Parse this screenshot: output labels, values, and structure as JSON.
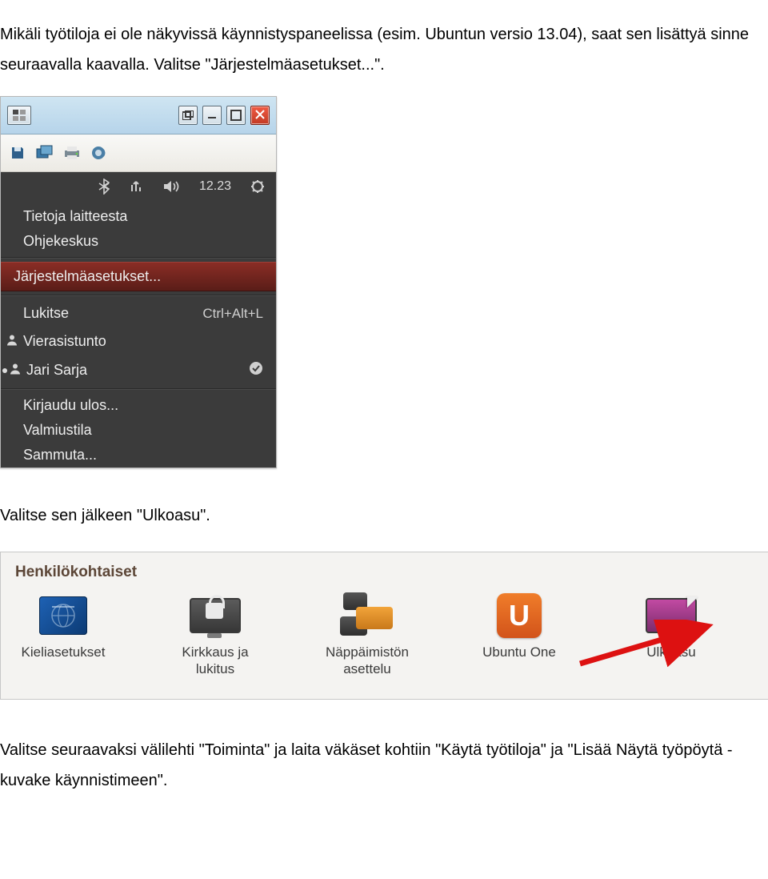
{
  "intro": "Mikäli työtiloja ei ole näkyvissä käynnistyspaneelissa (esim. Ubuntun versio 13.04), saat sen lisättyä sinne seuraavalla kaavalla. Valitse \"Järjestelmäasetukset...\".",
  "after_shot1": "Valitse sen jälkeen \"Ulkoasu\".",
  "outro": "Valitse seuraavaksi välilehti \"Toiminta\" ja laita väkäset kohtiin \"Käytä työtiloja\" ja \"Lisää Näytä työpöytä -kuvake käynnistimeen\".",
  "menu": {
    "time": "12.23",
    "items": {
      "about": "Tietoja laitteesta",
      "help": "Ohjekeskus",
      "settings": "Järjestelmäasetukset...",
      "lock": "Lukitse",
      "lock_shortcut": "Ctrl+Alt+L",
      "guest": "Vierasistunto",
      "user": "Jari Sarja",
      "logout": "Kirjaudu ulos...",
      "suspend": "Valmiustila",
      "shutdown": "Sammuta..."
    }
  },
  "panel": {
    "heading": "Henkilökohtaiset",
    "apps": {
      "lang": "Kieliasetukset",
      "bright": "Kirkkaus ja lukitus",
      "kb": "Näppäimistön asettelu",
      "uone": "Ubuntu One",
      "appearance": "Ulkoasu"
    }
  }
}
